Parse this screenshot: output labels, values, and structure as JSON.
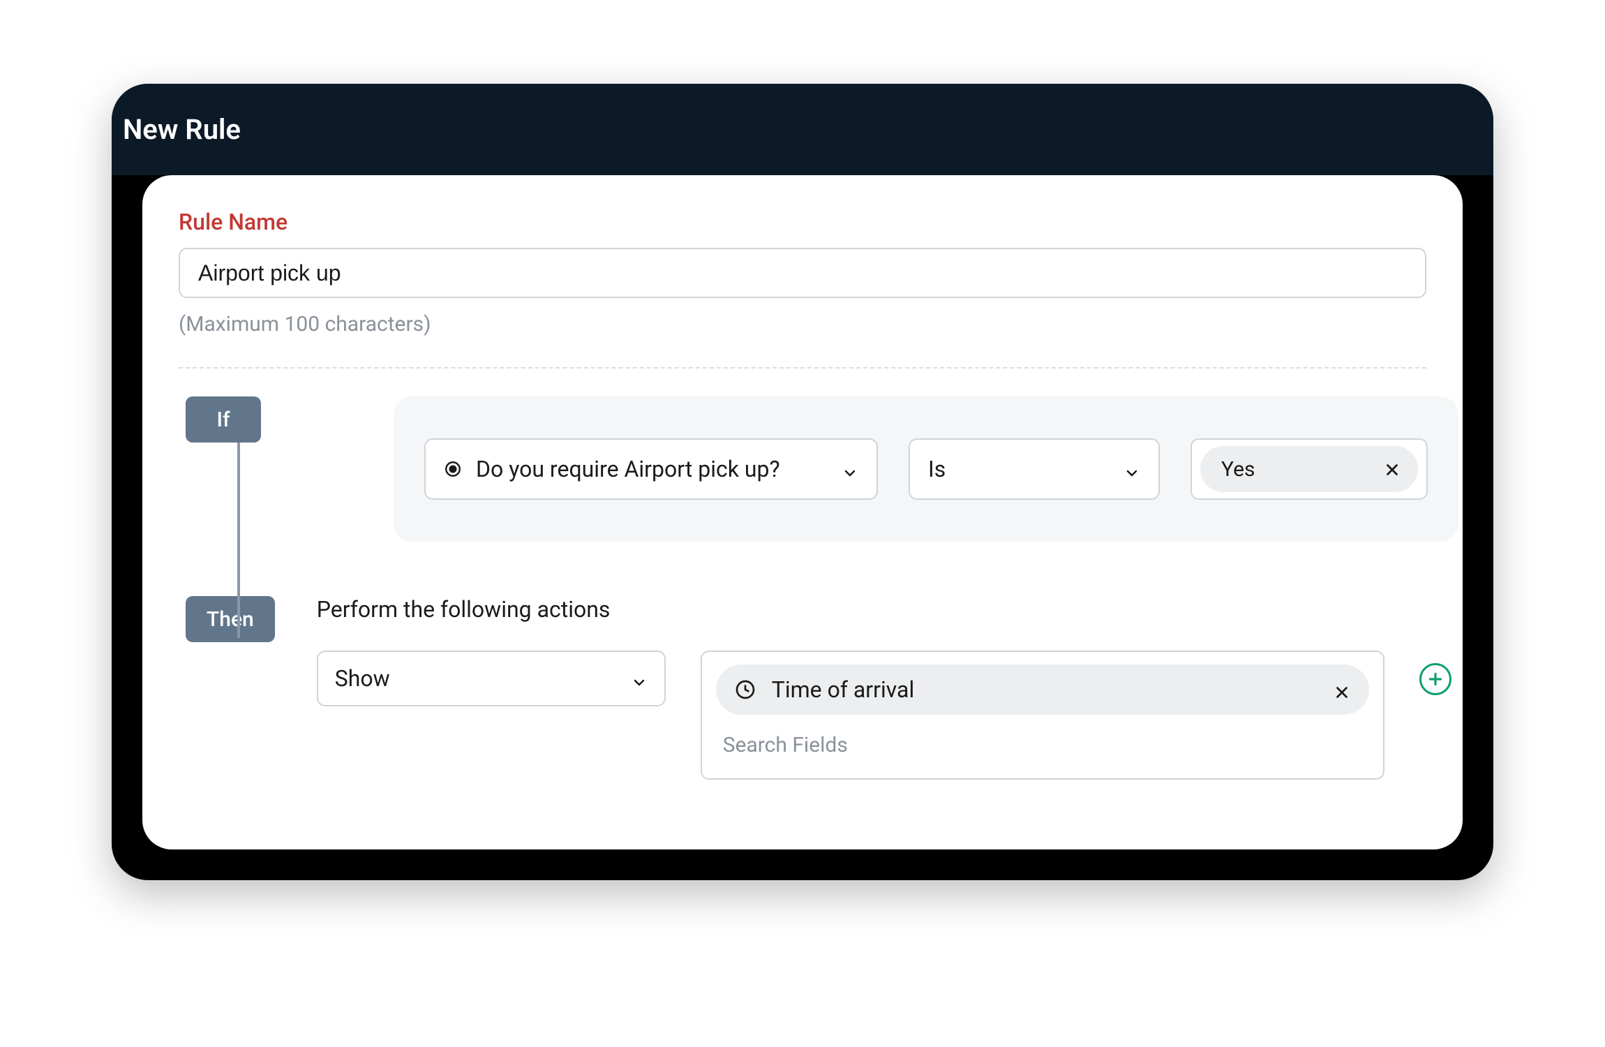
{
  "header": {
    "title": "New Rule"
  },
  "ruleName": {
    "label": "Rule Name",
    "value": "Airport pick up",
    "helper": "(Maximum 100 characters)"
  },
  "ifBlock": {
    "badge": "If",
    "field": "Do you require Airport pick up?",
    "operator": "Is",
    "value": "Yes"
  },
  "thenBlock": {
    "badge": "Then",
    "label": "Perform the following actions",
    "action": "Show",
    "target": "Time of arrival",
    "searchPlaceholder": "Search Fields"
  }
}
